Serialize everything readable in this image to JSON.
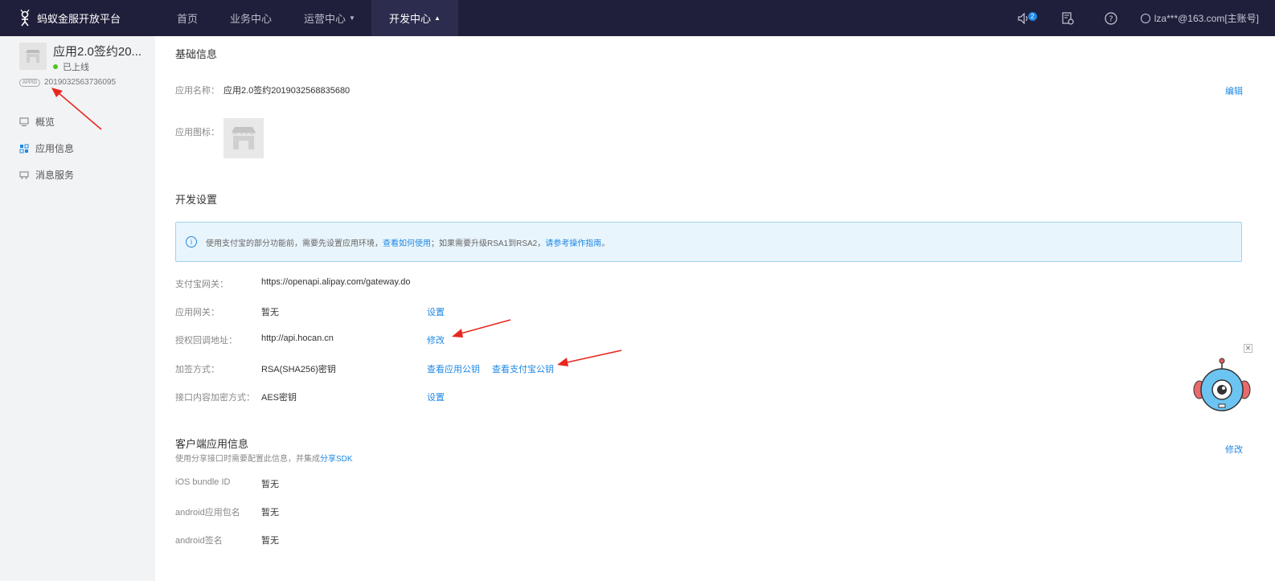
{
  "topbar": {
    "brand": "蚂蚁金服开放平台",
    "nav": [
      {
        "label": "首页",
        "active": false,
        "caret": false
      },
      {
        "label": "业务中心",
        "active": false,
        "caret": false
      },
      {
        "label": "运营中心",
        "active": false,
        "caret": true
      },
      {
        "label": "开发中心",
        "active": true,
        "caret": true
      }
    ],
    "badge": "2",
    "user": "lza***@163.com[主账号]"
  },
  "sidebar": {
    "app_name": "应用2.0签约20...",
    "status": "已上线",
    "appid_tag": "APPID",
    "appid": "2019032563736095",
    "menu": [
      {
        "label": "概览",
        "icon": "overview-icon"
      },
      {
        "label": "应用信息",
        "icon": "app-info-icon"
      },
      {
        "label": "消息服务",
        "icon": "message-icon"
      }
    ]
  },
  "basic": {
    "title": "基础信息",
    "name_label": "应用名称：",
    "name_value": "应用2.0签约2019032568835680",
    "edit": "编辑",
    "icon_label": "应用图标："
  },
  "dev": {
    "title": "开发设置",
    "notice_pre": "使用支付宝的部分功能前，需要先设置应用环境，",
    "notice_link1": "查看如何使用",
    "notice_mid": "；如果需要升级RSA1到RSA2，",
    "notice_link2": "请参考操作指南",
    "notice_end": "。",
    "rows": [
      {
        "label": "支付宝网关：",
        "value": "https://openapi.alipay.com/gateway.do",
        "links": []
      },
      {
        "label": "应用网关：",
        "value": "暂无",
        "links": [
          "设置"
        ]
      },
      {
        "label": "授权回调地址：",
        "value": "http://api.hocan.cn",
        "links": [
          "修改"
        ]
      },
      {
        "label": "加签方式：",
        "value": "RSA(SHA256)密钥",
        "links": [
          "查看应用公钥",
          "查看支付宝公钥"
        ]
      },
      {
        "label": "接口内容加密方式：",
        "value": "AES密钥",
        "links": [
          "设置"
        ]
      }
    ]
  },
  "client": {
    "title": "客户端应用信息",
    "desc_pre": "使用分享接口时需要配置此信息，并集成",
    "desc_link": "分享SDK",
    "edit": "修改",
    "rows": [
      {
        "label": "iOS bundle ID",
        "value": "暂无"
      },
      {
        "label": "android应用包名",
        "value": "暂无"
      },
      {
        "label": "android签名",
        "value": "暂无"
      }
    ]
  },
  "colors": {
    "topbar": "#1f1f3b",
    "accent": "#1e88e5",
    "annotation": "#e8281f"
  }
}
